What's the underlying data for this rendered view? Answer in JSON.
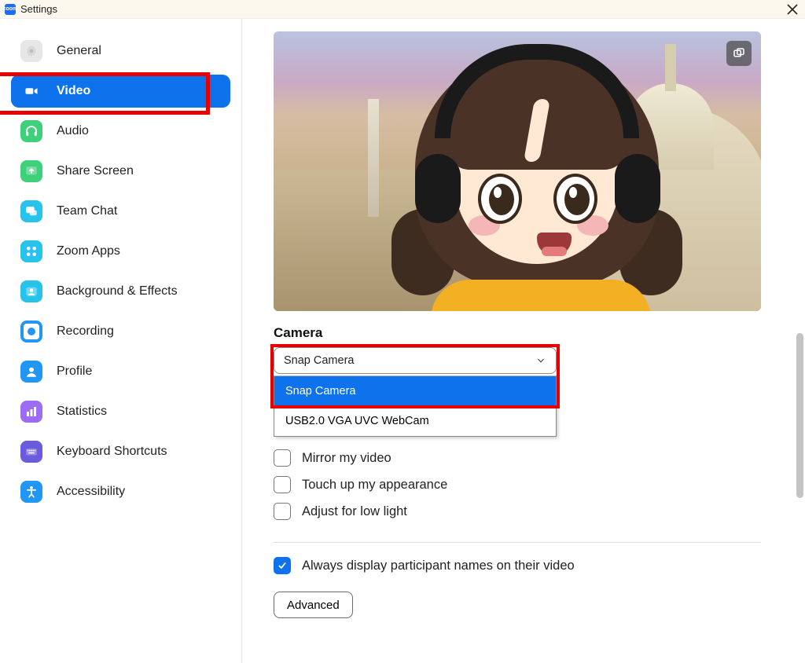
{
  "titlebar": {
    "app_abbrev": "zoom",
    "title": "Settings"
  },
  "sidebar": {
    "items": [
      {
        "label": "General"
      },
      {
        "label": "Video"
      },
      {
        "label": "Audio"
      },
      {
        "label": "Share Screen"
      },
      {
        "label": "Team Chat"
      },
      {
        "label": "Zoom Apps"
      },
      {
        "label": "Background & Effects"
      },
      {
        "label": "Recording"
      },
      {
        "label": "Profile"
      },
      {
        "label": "Statistics"
      },
      {
        "label": "Keyboard Shortcuts"
      },
      {
        "label": "Accessibility"
      }
    ],
    "active_index": 1
  },
  "video": {
    "camera_section_label": "Camera",
    "camera_selected": "Snap Camera",
    "camera_options": [
      "Snap Camera",
      "USB2.0 VGA UVC WebCam"
    ],
    "camera_dropdown_highlight_index": 0,
    "checks": {
      "mirror": {
        "label": "Mirror my video",
        "checked": false
      },
      "touchup": {
        "label": "Touch up my appearance",
        "checked": false
      },
      "lowlight": {
        "label": "Adjust for low light",
        "checked": false
      }
    },
    "always_names": {
      "label": "Always display participant names on their video",
      "checked": true
    },
    "advanced_label": "Advanced"
  },
  "colors": {
    "accent": "#0e72ec",
    "highlight_border": "#e60000"
  }
}
